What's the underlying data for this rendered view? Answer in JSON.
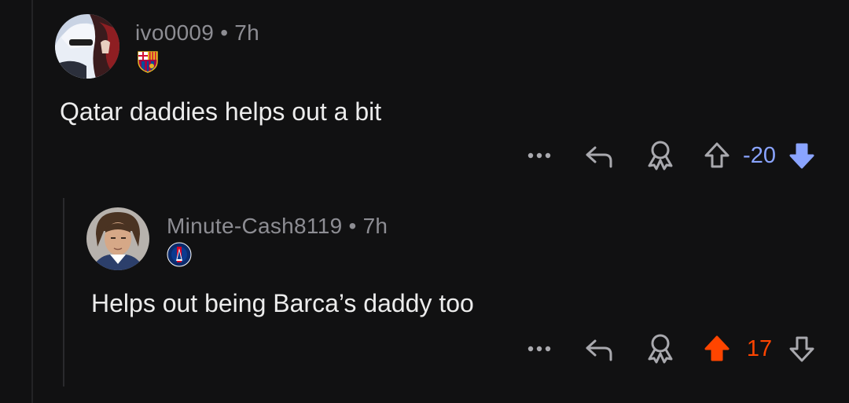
{
  "comments": [
    {
      "username": "ivo0009",
      "separator": "•",
      "age": "7h",
      "body": "Qatar daddies helps out a bit",
      "score": "-20",
      "score_color": "#8aa4ff",
      "vote_state": "downvoted"
    },
    {
      "username": "Minute-Cash8119",
      "separator": "•",
      "age": "7h",
      "body": "Helps out being Barca’s daddy too",
      "score": "17",
      "score_color": "#ff4500",
      "vote_state": "upvoted"
    }
  ],
  "icons": {
    "more": "more-dots-icon",
    "reply": "reply-icon",
    "award": "award-icon",
    "upvote": "upvote-arrow-icon",
    "downvote": "downvote-arrow-icon"
  },
  "colors": {
    "background": "#111112",
    "upvote_active": "#ff4500",
    "downvote_active": "#8aa4ff",
    "muted": "#8d8d93"
  }
}
